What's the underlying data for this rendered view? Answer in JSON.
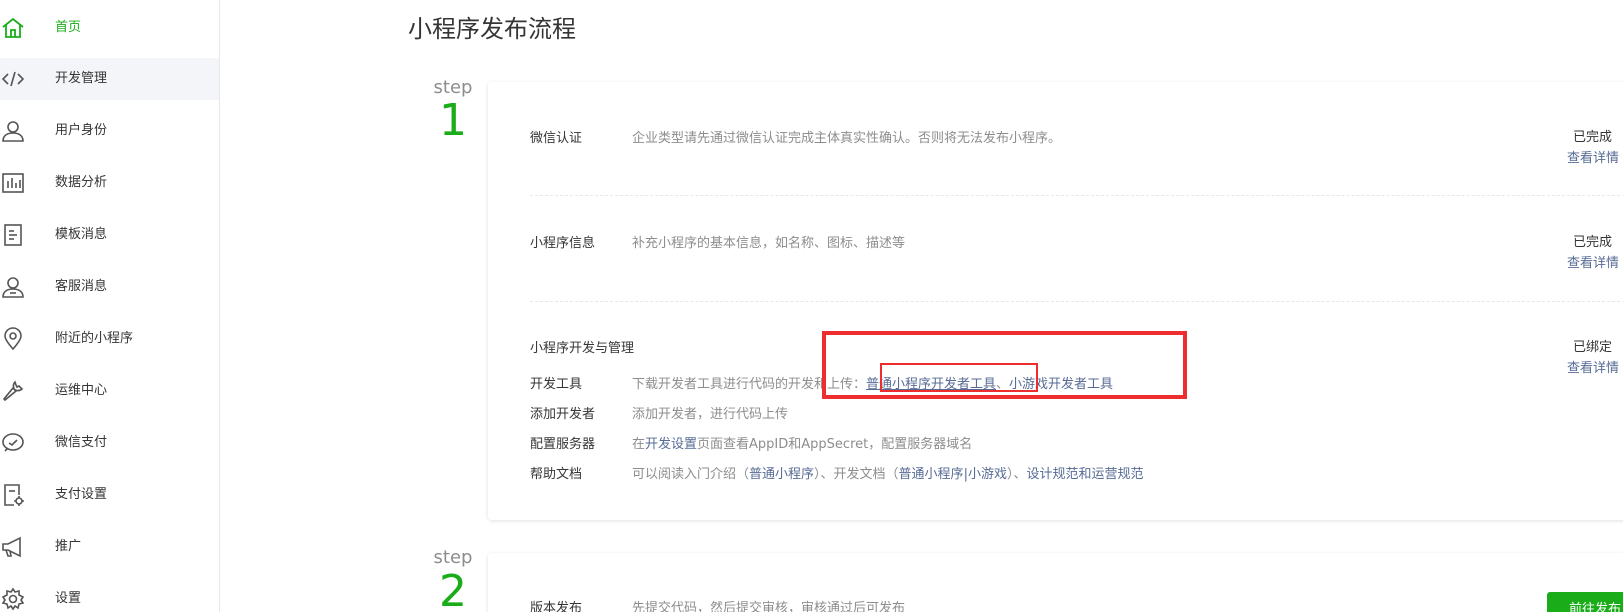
{
  "sidebar": {
    "items": [
      {
        "label": "首页",
        "icon": "home-icon"
      },
      {
        "label": "开发管理",
        "icon": "code-icon"
      },
      {
        "label": "用户身份",
        "icon": "user-icon"
      },
      {
        "label": "数据分析",
        "icon": "chart-icon"
      },
      {
        "label": "模板消息",
        "icon": "document-icon"
      },
      {
        "label": "客服消息",
        "icon": "customer-service-icon"
      },
      {
        "label": "附近的小程序",
        "icon": "location-icon"
      },
      {
        "label": "运维中心",
        "icon": "wrench-icon"
      },
      {
        "label": "微信支付",
        "icon": "payment-icon"
      },
      {
        "label": "支付设置",
        "icon": "payment-settings-icon"
      },
      {
        "label": "推广",
        "icon": "megaphone-icon"
      },
      {
        "label": "设置",
        "icon": "gear-icon"
      }
    ]
  },
  "main": {
    "title": "小程序发布流程",
    "step1": {
      "label": "step",
      "number": "1",
      "rows": {
        "wechat_auth": {
          "title": "微信认证",
          "desc": "企业类型请先通过微信认证完成主体真实性确认。否则将无法发布小程序。",
          "status": "已完成",
          "detail": "查看详情"
        },
        "info": {
          "title": "小程序信息",
          "desc": "补充小程序的基本信息，如名称、图标、描述等",
          "status": "已完成",
          "detail": "查看详情"
        },
        "dev": {
          "title": "小程序开发与管理",
          "status": "已绑定",
          "detail": "查看详情",
          "tools": {
            "title": "开发工具",
            "desc_prefix": "下载开发者工具进行代码的开发和上传：",
            "link1": "普通小程序开发者工具",
            "sep": "、",
            "link2": "小游戏开发者工具"
          },
          "add_dev": {
            "title": "添加开发者",
            "desc": "添加开发者，进行代码上传"
          },
          "server": {
            "title": "配置服务器",
            "desc_prefix": "在",
            "link": "开发设置",
            "desc_suffix": "页面查看AppID和AppSecret，配置服务器域名"
          },
          "help": {
            "title": "帮助文档",
            "t1": "可以阅读入门介绍（",
            "l1": "普通小程序",
            "t2": "）、开发文档（",
            "l2": "普通小程序",
            "t3": "|",
            "l3": "小游戏",
            "t4": "）、",
            "l4": "设计规范",
            "t5": "和",
            "l5": "运营规范"
          }
        }
      }
    },
    "step2": {
      "label": "step",
      "number": "2",
      "title": "版本发布",
      "desc": "先提交代码，然后提交审核，审核通过后可发布",
      "button": "前往发布"
    }
  },
  "colors": {
    "accent": "#1aad19",
    "link": "#576b95",
    "annotation": "#ee2e2e"
  }
}
